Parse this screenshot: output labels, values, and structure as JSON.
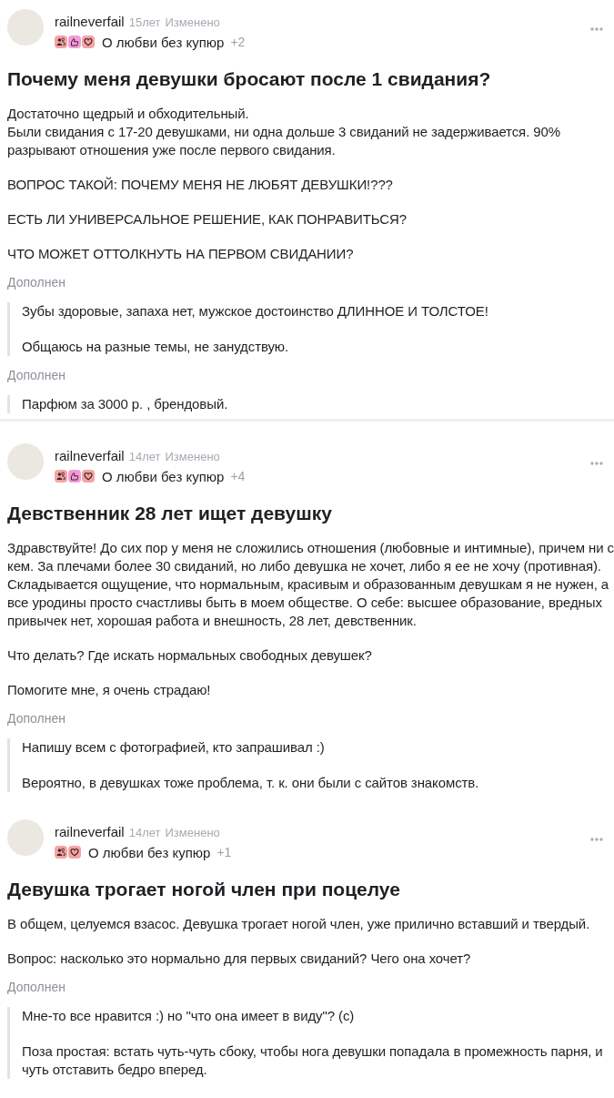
{
  "posts": [
    {
      "author": "railneverfail",
      "age": "15лет",
      "status": "Изменено",
      "badges": [
        {
          "kind": "people",
          "color": "#f6a3a3"
        },
        {
          "kind": "hand",
          "color": "#f49ad8"
        },
        {
          "kind": "heart",
          "color": "#f6a3a3"
        }
      ],
      "community": "О любви без купюр",
      "more_count": "+2",
      "title": "Почему меня девушки бросают после 1 свидания?",
      "body": [
        "Достаточно щедрый и обходительный.\nБыли свидания с 17-20 девушками, ни одна дольше 3 свиданий не задерживается. 90% разрывают отношения уже после первого свидания.",
        "ВОПРОС ТАКОЙ: ПОЧЕМУ МЕНЯ НЕ ЛЮБЯТ ДЕВУШКИ!???",
        "ЕСТЬ ЛИ УНИВЕРСАЛЬНОЕ РЕШЕНИЕ, КАК ПОНРАВИТЬСЯ?",
        "ЧТО МОЖЕТ ОТТОЛКНУТЬ НА ПЕРВОМ СВИДАНИИ?"
      ],
      "additions": [
        {
          "label": "Дополнен",
          "paragraphs": [
            "Зубы здоровые, запаха нет, мужское достоинство ДЛИННОЕ И ТОЛСТОЕ!",
            "Общаюсь на разные темы, не занудствую."
          ]
        },
        {
          "label": "Дополнен",
          "paragraphs": [
            "Парфюм за 3000 р. , брендовый."
          ]
        }
      ],
      "divider_below": true
    },
    {
      "author": "railneverfail",
      "age": "14лет",
      "status": "Изменено",
      "badges": [
        {
          "kind": "people",
          "color": "#f6a3a3"
        },
        {
          "kind": "hand",
          "color": "#f49ad8"
        },
        {
          "kind": "heart",
          "color": "#f6a3a3"
        }
      ],
      "community": "О любви без купюр",
      "more_count": "+4",
      "title": "Девственник 28 лет ищет девушку",
      "body": [
        "Здравствуйте! До сих пор у меня не сложились отношения (любовные и интимные), причем ни с кем. За плечами более 30 свиданий, но либо девушка не хочет, либо я ее не хочу (противная). Складывается ощущение, что нормальным, красивым и образованным девушкам я не нужен, а все уродины просто счастливы быть в моем обществе. О себе: высшее образование, вредных привычек нет, хорошая работа и внешность, 28 лет, девственник.",
        "Что делать? Где искать нормальных свободных девушек?",
        "Помогите мне, я очень страдаю!"
      ],
      "additions": [
        {
          "label": "Дополнен",
          "paragraphs": [
            "Напишу всем с фотографией, кто запрашивал :)",
            "Вероятно, в девушках тоже проблема, т. к. они были с сайтов знакомств."
          ]
        }
      ],
      "divider_below": false
    },
    {
      "author": "railneverfail",
      "age": "14лет",
      "status": "Изменено",
      "badges": [
        {
          "kind": "people",
          "color": "#f6a3a3"
        },
        {
          "kind": "heart",
          "color": "#f6a3a3"
        }
      ],
      "community": "О любви без купюр",
      "more_count": "+1",
      "title": "Девушка трогает ногой член при поцелуе",
      "body": [
        "В общем, целуемся взасос. Девушка трогает ногой член, уже прилично вставший и твердый.",
        "Вопрос: насколько это нормально для первых свиданий? Чего она хочет?"
      ],
      "additions": [
        {
          "label": "Дополнен",
          "paragraphs": [
            "Мне-то все нравится :) но \"что она имеет в виду\"? (с)",
            "Поза простая: встать чуть-чуть сбоку, чтобы нога девушки попадала в промежность парня, и чуть отставить бедро вперед."
          ]
        }
      ],
      "divider_below": false
    }
  ]
}
